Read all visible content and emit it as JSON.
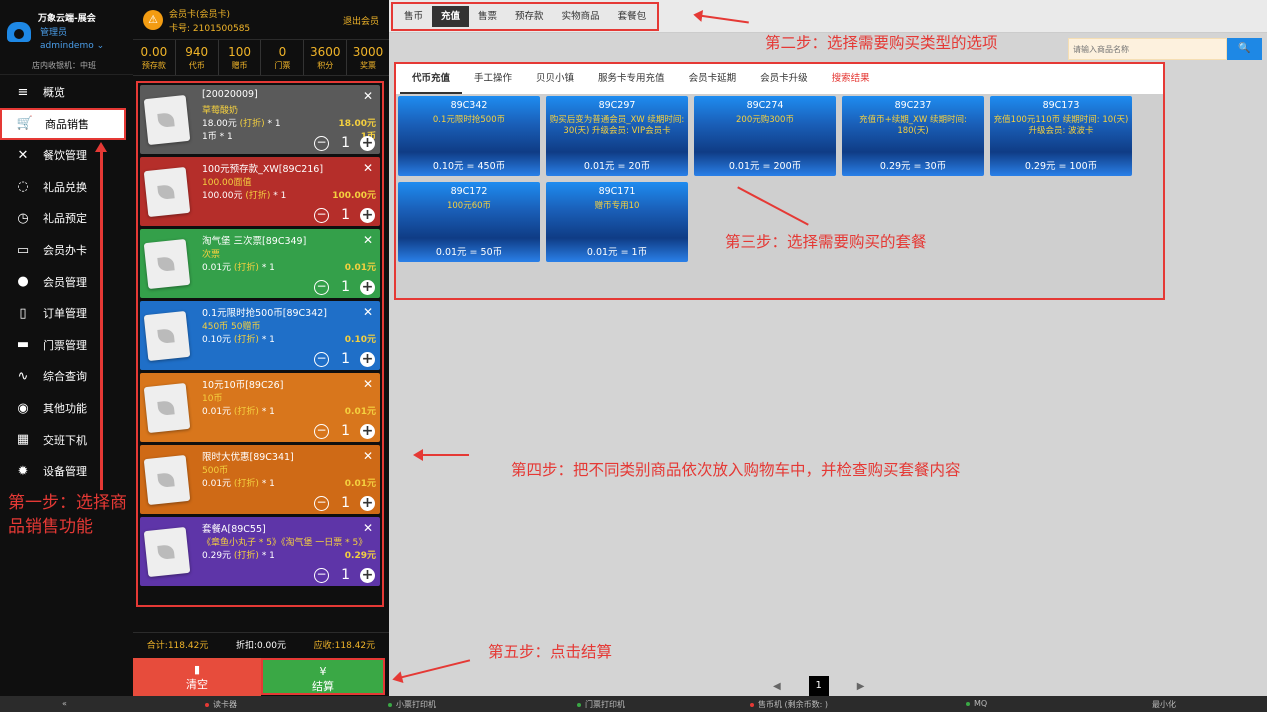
{
  "brand": {
    "name": "万象云端-展会",
    "role": "管理员",
    "user": "admindemo ⌄",
    "cashier": "店内收银机：中班"
  },
  "nav": [
    {
      "label": "概览",
      "icon": "≡",
      "name": "nav-overview"
    },
    {
      "label": "商品销售",
      "icon": "🛒",
      "name": "nav-product-sales"
    },
    {
      "label": "餐饮管理",
      "icon": "✕",
      "name": "nav-catering"
    },
    {
      "label": "礼品兑换",
      "icon": "◌",
      "name": "nav-gift-exchange"
    },
    {
      "label": "礼品预定",
      "icon": "◷",
      "name": "nav-gift-booking"
    },
    {
      "label": "会员办卡",
      "icon": "▭",
      "name": "nav-member-card"
    },
    {
      "label": "会员管理",
      "icon": "●",
      "name": "nav-member-manage"
    },
    {
      "label": "订单管理",
      "icon": "▯",
      "name": "nav-order-manage"
    },
    {
      "label": "门票管理",
      "icon": "▬",
      "name": "nav-ticket-manage"
    },
    {
      "label": "综合查询",
      "icon": "∿",
      "name": "nav-query"
    },
    {
      "label": "其他功能",
      "icon": "◉",
      "name": "nav-other"
    },
    {
      "label": "交班下机",
      "icon": "▦",
      "name": "nav-shift"
    },
    {
      "label": "设备管理",
      "icon": "✹",
      "name": "nav-device"
    }
  ],
  "member": {
    "avatar": "⚠",
    "title": "会员卡(会员卡)",
    "card": "卡号: 2101500585",
    "exit": "退出会员"
  },
  "stats": [
    {
      "value": "0.00",
      "label": "预存款"
    },
    {
      "value": "940",
      "label": "代币"
    },
    {
      "value": "100",
      "label": "赠币"
    },
    {
      "value": "0",
      "label": "门票"
    },
    {
      "value": "3600",
      "label": "积分"
    },
    {
      "value": "3000",
      "label": "奖票"
    }
  ],
  "cart": [
    {
      "name": "[20020009]",
      "desc": "草莓酸奶",
      "price": "18.00元",
      "discount": "(打折)",
      "mult": " * 1",
      "total": "18.00元",
      "extra": "1币 * 1",
      "extra_total": "1币",
      "qty": "1",
      "color": "#5a5a5a"
    },
    {
      "name": "100元预存款_XW[89C216]",
      "desc": "100.00面值",
      "price": "100.00元",
      "discount": "(打折)",
      "mult": " * 1",
      "total": "100.00元",
      "extra": "",
      "extra_total": "",
      "qty": "1",
      "color": "#b52e2a"
    },
    {
      "name": "淘气堡 三次票[89C349]",
      "desc": "次票",
      "price": "0.01元",
      "discount": "(打折)",
      "mult": " * 1",
      "total": "0.01元",
      "extra": "",
      "extra_total": "",
      "qty": "1",
      "color": "#34a04a"
    },
    {
      "name": "0.1元限时抢500币[89C342]",
      "desc": "450币 50赠币",
      "price": "0.10元",
      "discount": "(打折)",
      "mult": " * 1",
      "total": "0.10元",
      "extra": "",
      "extra_total": "",
      "qty": "1",
      "color": "#1f6fc8"
    },
    {
      "name": "10元10币[89C26]",
      "desc": "10币",
      "price": "0.01元",
      "discount": "(打折)",
      "mult": " * 1",
      "total": "0.01元",
      "extra": "",
      "extra_total": "",
      "qty": "1",
      "color": "#d8761c"
    },
    {
      "name": "限时大优惠[89C341]",
      "desc": "500币",
      "price": "0.01元",
      "discount": "(打折)",
      "mult": " * 1",
      "total": "0.01元",
      "extra": "",
      "extra_total": "",
      "qty": "1",
      "color": "#cf6a16"
    },
    {
      "name": "套餐A[89C55]",
      "desc": "《章鱼小丸子 * 5》《淘气堡 一日票 * 5》",
      "price": "0.29元",
      "discount": "(打折)",
      "mult": " * 1",
      "total": "0.29元",
      "extra": "",
      "extra_total": "",
      "qty": "1",
      "color": "#5e35a8"
    }
  ],
  "totals": {
    "sum": "合计:118.42元",
    "discount": "折扣:0.00元",
    "due": "应收:118.42元"
  },
  "buttons": {
    "clear_icon": "▮",
    "clear": "清空",
    "pay_icon": "¥",
    "pay": "结算"
  },
  "top_tabs": [
    "售币",
    "充值",
    "售票",
    "预存款",
    "实物商品",
    "套餐包"
  ],
  "search": {
    "placeholder": "请输入商品名称",
    "btn": "🔍"
  },
  "sub_tabs": [
    "代币充值",
    "手工操作",
    "贝贝小镇",
    "服务卡专用充值",
    "会员卡延期",
    "会员卡升级",
    "搜索结果"
  ],
  "products": [
    {
      "code": "89C342",
      "desc": "0.1元限时抢500币",
      "price": "0.10元 = 450币"
    },
    {
      "code": "89C297",
      "desc": "购买后变为普通会员_XW 续期时间: 30(天) 升级会员: VIP会员卡",
      "price": "0.01元 = 20币"
    },
    {
      "code": "89C274",
      "desc": "200元购300币",
      "price": "0.01元 = 200币"
    },
    {
      "code": "89C237",
      "desc": "充值币+续期_XW 续期时间: 180(天)",
      "price": "0.29元 = 30币"
    },
    {
      "code": "89C173",
      "desc": "充值100元110币 续期时间: 10(天) 升级会员: 波波卡",
      "price": "0.29元 = 100币"
    },
    {
      "code": "89C172",
      "desc": "100元60币",
      "price": "0.01元 = 50币"
    },
    {
      "code": "89C171",
      "desc": "赠币专用10",
      "price": "0.01元 = 1币"
    }
  ],
  "annotations": {
    "step1": "第一步：选择商品销售功能",
    "step2": "第二步：选择需要购买类型的选项",
    "step3": "第三步：选择需要购买的套餐",
    "step4": "第四步：把不同类别商品依次放入购物车中，并检查购买套餐内容",
    "step5": "第五步：点击结算"
  },
  "pager": {
    "prev": "◀",
    "page": "1",
    "next": "▶"
  },
  "status": [
    {
      "text": "«",
      "color": ""
    },
    {
      "text": "读卡器",
      "color": "#e53935"
    },
    {
      "text": "小票打印机",
      "color": "#3aa845"
    },
    {
      "text": "门票打印机",
      "color": "#3aa845"
    },
    {
      "text": "售币机 (剩余币数: )",
      "color": "#e53935"
    },
    {
      "text": "MQ",
      "color": "#3aa845"
    },
    {
      "text": "最小化",
      "color": ""
    }
  ]
}
